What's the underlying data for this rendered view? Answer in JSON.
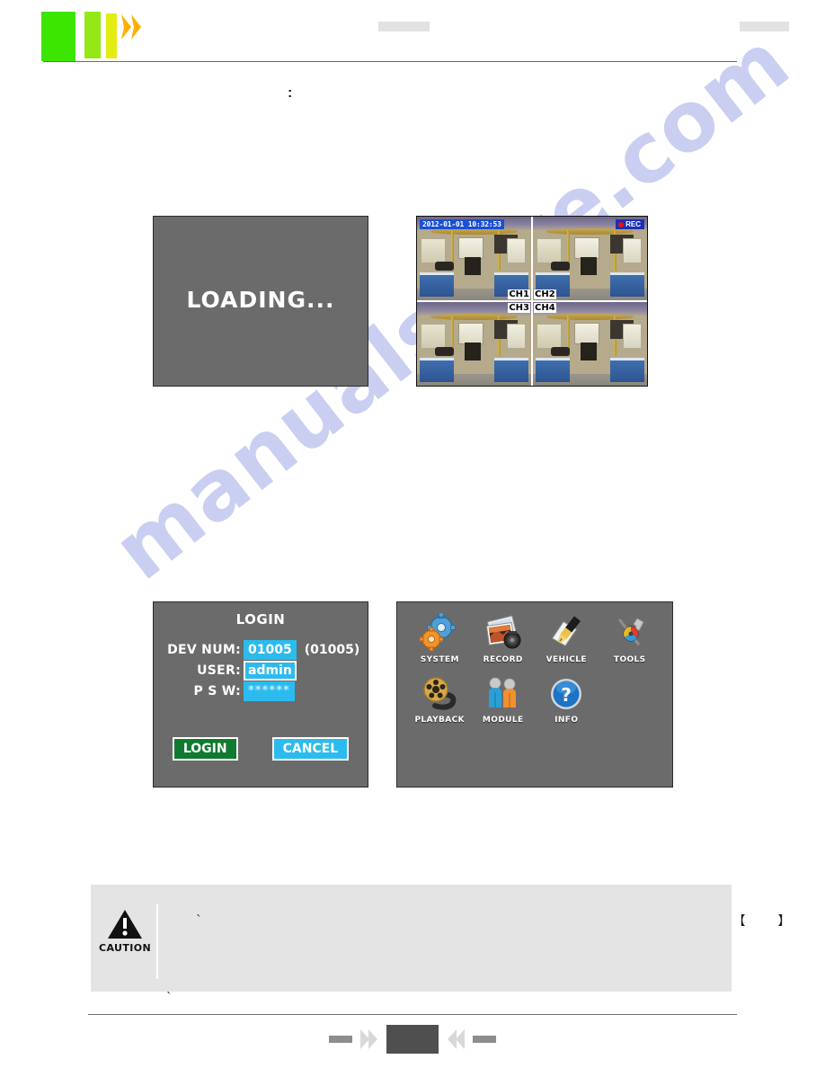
{
  "header": {
    "logo_alt": "company-logo",
    "redaction_left": "",
    "redaction_right": "",
    "colon_mark": ":"
  },
  "loading_screen": {
    "label": "LOADING..."
  },
  "live_view": {
    "timestamp": "2012-01-01 10:32:53",
    "rec_label": "REC",
    "channels": [
      {
        "id": "ch1",
        "label": "CH1"
      },
      {
        "id": "ch2",
        "label": "CH2"
      },
      {
        "id": "ch3",
        "label": "CH3"
      },
      {
        "id": "ch4",
        "label": "CH4"
      }
    ]
  },
  "login_dialog": {
    "title": "LOGIN",
    "fields": [
      {
        "label": "DEV NUM:",
        "value": "01005",
        "hint": "(01005)",
        "focused": false
      },
      {
        "label": "USER:",
        "value": "admin",
        "hint": "",
        "focused": true
      },
      {
        "label": "P S W:",
        "value": "******",
        "hint": "",
        "focused": false
      }
    ],
    "buttons": {
      "login": "LOGIN",
      "cancel": "CANCEL"
    }
  },
  "main_menu": {
    "items": [
      {
        "label": "SYSTEM",
        "icon": "gears-icon"
      },
      {
        "label": "RECORD",
        "icon": "photos-camera-icon"
      },
      {
        "label": "VEHICLE",
        "icon": "pen-document-icon"
      },
      {
        "label": "TOOLS",
        "icon": "wrench-screwdriver-icon"
      },
      {
        "label": "PLAYBACK",
        "icon": "film-reel-icon"
      },
      {
        "label": "MODULE",
        "icon": "two-people-icon"
      },
      {
        "label": "INFO",
        "icon": "question-mark-icon"
      }
    ]
  },
  "caution_box": {
    "icon": "warning-triangle-icon",
    "word": "CAUTION",
    "line1": "`",
    "line1_bracket_open": "【",
    "line1_bracket_close": "】",
    "line2": "`"
  },
  "footer": {
    "prev_marker": "",
    "page_block": "",
    "next_marker": ""
  },
  "watermark": {
    "text": "manualshive.com"
  },
  "colors": {
    "logo_green": "#3ce600",
    "logo_yellow_green": "#93e815",
    "logo_yellow": "#e3ec10",
    "logo_orange": "#ffb000",
    "screen_gray": "#6b6b6b",
    "field_cyan": "#2cbbee",
    "login_green": "#0f7a30",
    "timestamp_blue": "#1a4fd6",
    "rec_red": "#e81111",
    "caution_bg": "#e4e4e4",
    "watermark_blue": "#9fa8e8"
  }
}
